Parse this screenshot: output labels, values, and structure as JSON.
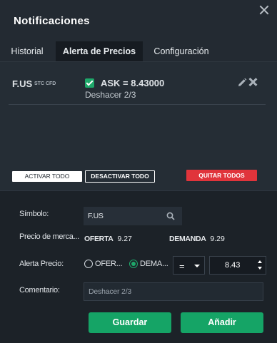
{
  "window": {
    "title": "Notificaciones"
  },
  "tabs": [
    {
      "label": "Historial",
      "active": false
    },
    {
      "label": "Alerta de Precios",
      "active": true
    },
    {
      "label": "Configuración",
      "active": false
    }
  ],
  "alerts": [
    {
      "symbol": "F.US",
      "symbol_tag": "STC CFD",
      "enabled": true,
      "condition": "ASK = 8.43000",
      "comment": "Deshacer 2/3"
    }
  ],
  "alert_actions": {
    "activate_all": "ACTIVAR TODO",
    "deactivate_all": "DESACTIVAR TODO",
    "remove_all": "QUITAR TODOS"
  },
  "form": {
    "symbol_label": "Símbolo:",
    "symbol_value": "F.US",
    "market_price_label": "Precio de merca...",
    "bid_label": "OFERTA",
    "bid_value": "9.27",
    "ask_label": "DEMANDA",
    "ask_value": "9.29",
    "price_alert_label": "Alerta Precio:",
    "radio_bid_label": "OFER...",
    "radio_ask_label": "DEMA...",
    "selected_radio": "ask",
    "operator_value": "=",
    "price_value": "8.43",
    "comment_label": "Comentario:",
    "comment_value": "Deshacer 2/3",
    "save_label": "Guardar",
    "add_label": "Añadir"
  },
  "colors": {
    "accent_green": "#15a466",
    "danger_red": "#e0343b",
    "background": "#1f262e"
  },
  "icons": [
    "close-icon",
    "checkbox-checked-icon",
    "pencil-icon",
    "delete-x-icon",
    "search-icon",
    "chevron-down-icon",
    "spinner-arrows-icon"
  ]
}
